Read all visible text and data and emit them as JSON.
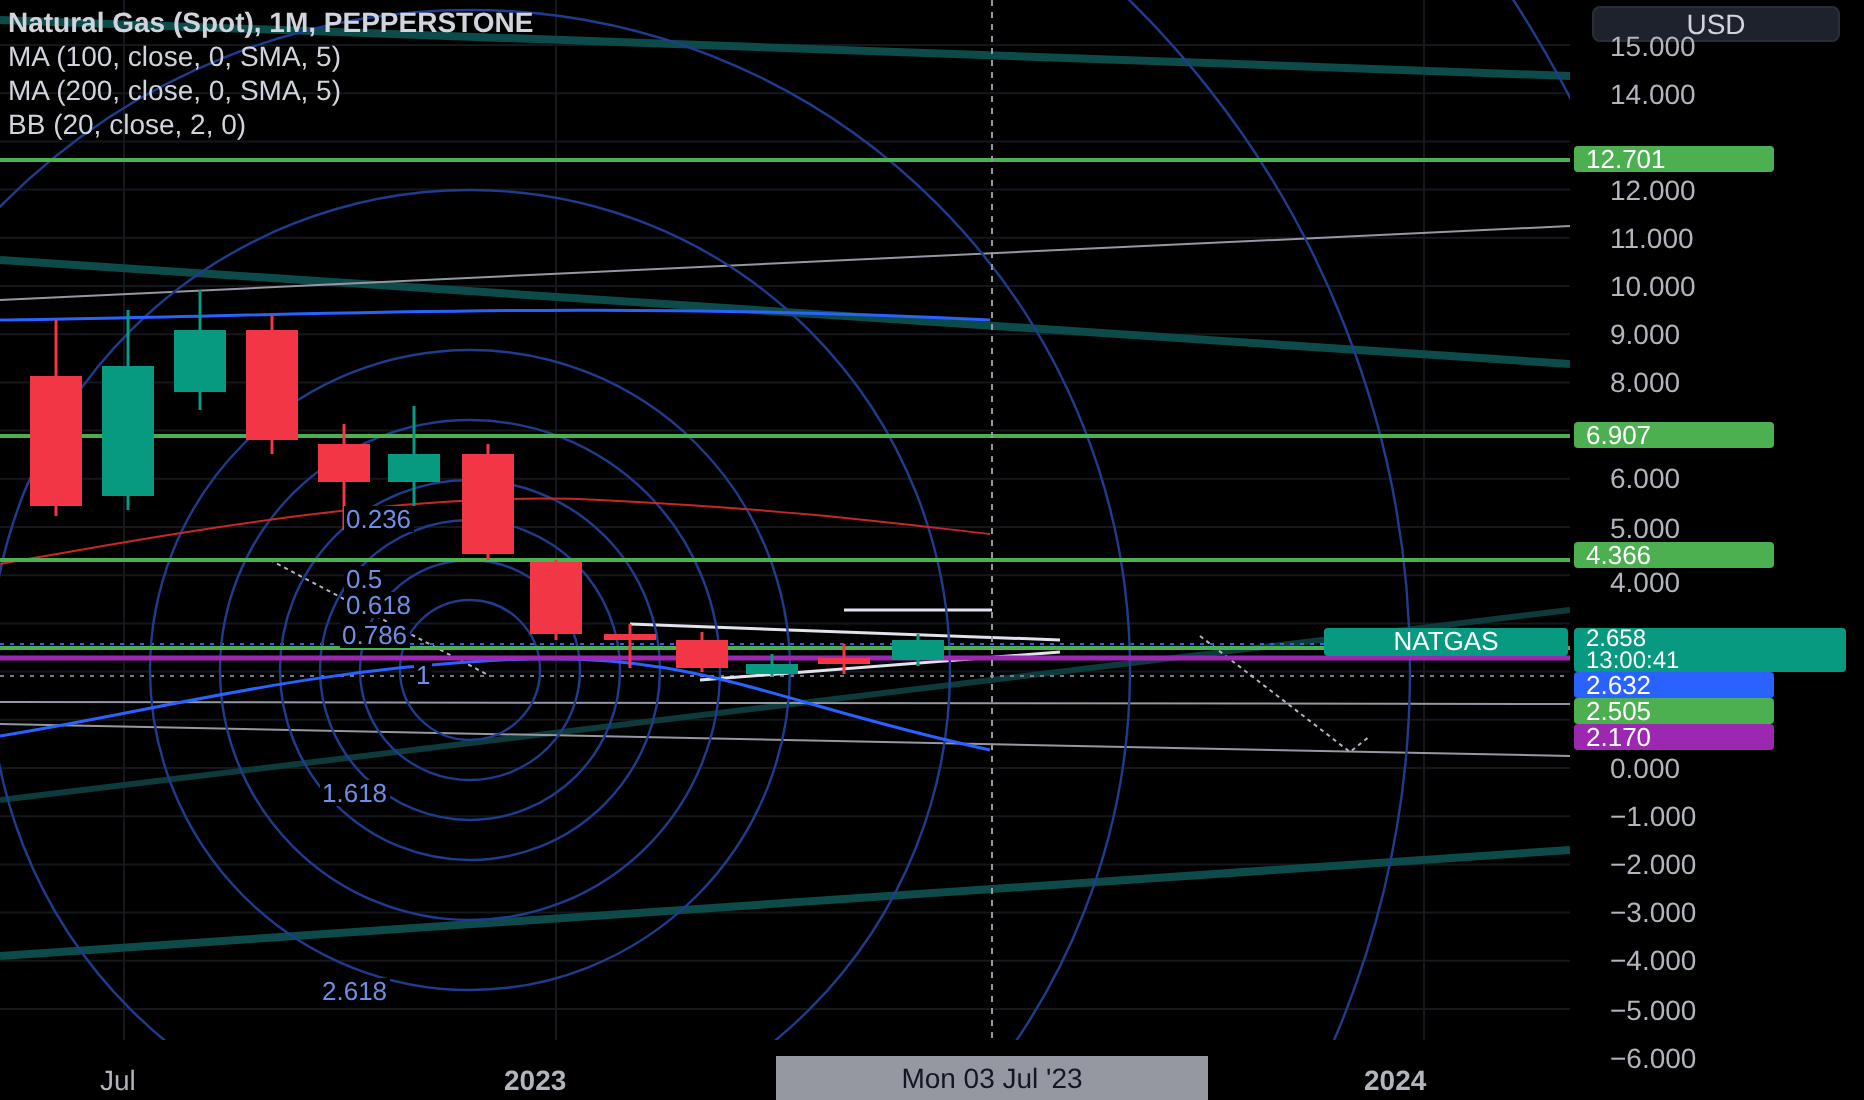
{
  "legend": [
    {
      "text": "Natural Gas (Spot), 1M, PEPPERSTONE",
      "kind": "symbol"
    },
    {
      "text": "MA (100, close, 0, SMA, 5)",
      "kind": "indicator"
    },
    {
      "text": "MA (200, close, 0, SMA, 5)",
      "kind": "indicator"
    },
    {
      "text": "BB (20, close, 2, 0)",
      "kind": "indicator"
    }
  ],
  "currency_button": "USD",
  "price_axis": [
    "15.000",
    "14.000",
    "12.000",
    "11.000",
    "10.000",
    "9.000",
    "8.000",
    "6.000",
    "5.000",
    "4.000",
    "0.000",
    "−1.000",
    "−2.000",
    "−3.000",
    "−4.000",
    "−5.000",
    "−6.000"
  ],
  "price_tags": [
    {
      "text": "12.701",
      "color": "#4caf50"
    },
    {
      "text": "6.907",
      "color": "#4caf50"
    },
    {
      "text": "4.366",
      "color": "#4caf50"
    },
    {
      "text": "2.632",
      "color": "#2962ff"
    },
    {
      "text": "2.505",
      "color": "#4caf50"
    },
    {
      "text": "2.170",
      "color": "#9c27b0"
    }
  ],
  "symbol_tag": {
    "text": "NATGAS",
    "price": "2.658",
    "countdown": "13:00:41",
    "color": "#089981"
  },
  "fib_labels": [
    "0.236",
    "0.5",
    "0.618",
    "0.786",
    "1",
    "1.618",
    "2.618"
  ],
  "time_axis": [
    "Jul",
    "2023",
    "2024"
  ],
  "crosshair_label": "Mon 03 Jul '23"
}
